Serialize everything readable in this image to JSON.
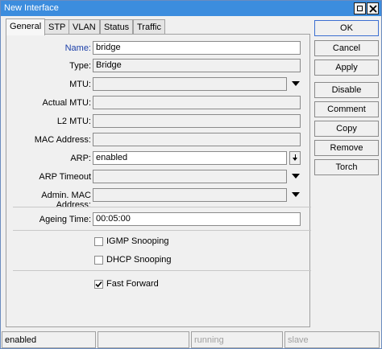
{
  "window": {
    "title": "New Interface"
  },
  "tabs": [
    "General",
    "STP",
    "VLAN",
    "Status",
    "Traffic"
  ],
  "form": {
    "name": {
      "label": "Name:",
      "value": "bridge"
    },
    "type": {
      "label": "Type:",
      "value": "Bridge"
    },
    "mtu": {
      "label": "MTU:",
      "value": ""
    },
    "actual_mtu": {
      "label": "Actual MTU:",
      "value": ""
    },
    "l2_mtu": {
      "label": "L2 MTU:",
      "value": ""
    },
    "mac_address": {
      "label": "MAC Address:",
      "value": ""
    },
    "arp": {
      "label": "ARP:",
      "value": "enabled"
    },
    "arp_timeout": {
      "label": "ARP Timeout",
      "value": ""
    },
    "admin_mac": {
      "label": "Admin. MAC Address:",
      "value": ""
    },
    "ageing_time": {
      "label": "Ageing Time:",
      "value": "00:05:00"
    },
    "igmp_snooping": {
      "label": "IGMP Snooping",
      "checked": false
    },
    "dhcp_snooping": {
      "label": "DHCP Snooping",
      "checked": false
    },
    "fast_forward": {
      "label": "Fast Forward",
      "checked": true
    }
  },
  "buttons": [
    "OK",
    "Cancel",
    "Apply",
    "Disable",
    "Comment",
    "Copy",
    "Remove",
    "Torch"
  ],
  "status": [
    "enabled",
    "",
    "running",
    "slave"
  ]
}
